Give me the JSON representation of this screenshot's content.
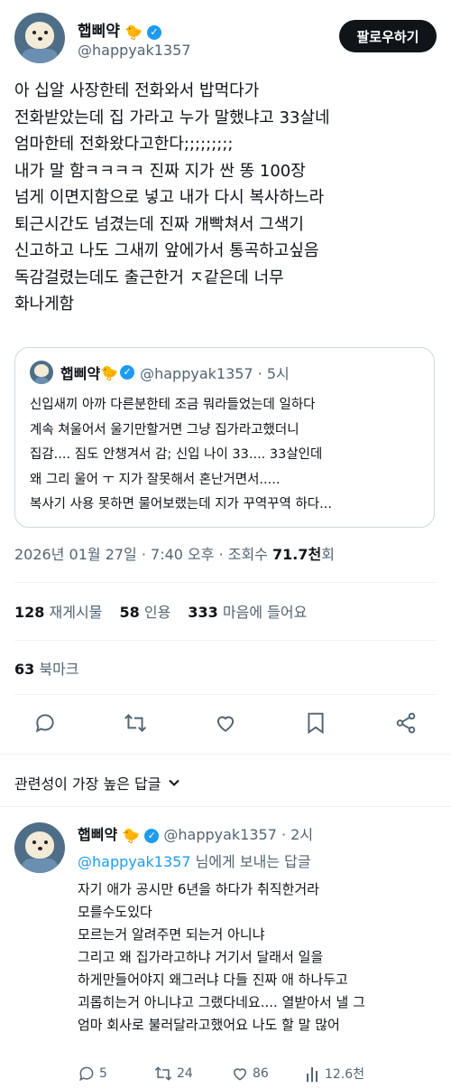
{
  "header": {
    "display_name": "햅삐약",
    "handle": "@happyak1357",
    "follow_label": "팔로우하기"
  },
  "tweet": {
    "lines": [
      "아 십알 사장한테 전화와서 밥먹다가",
      "전화받았는데 집 가라고 누가 말했냐고 33살네",
      "엄마한테 전화왔다고한다;;;;;;;;;",
      "내가 말 함ㅋㅋㅋㅋ 진짜 지가 싼 똥 100장",
      "넘게 이면지함으로 넣고 내가 다시 복사하느라",
      "퇴근시간도 넘겼는데 진짜 개빡쳐서 그색기",
      "신고하고 나도 그새끼 앞에가서 통곡하고싶음",
      "독감걸렸는데도 출근한거 ㅈ같은데 너무",
      "화나게함"
    ]
  },
  "quote": {
    "display_name": "햅삐약",
    "handle_time": "@happyak1357 · 5시",
    "lines": [
      "신입새끼 아까 다른분한테 조금 뭐라들었는데 일하다",
      "계속 쳐울어서 울기만할거면 그냥 집가라고했더니",
      "집감.... 짐도 안챙겨서 감; 신입 나이 33.... 33살인데",
      "왜 그리 울어 ㅜ 지가 잘못해서 혼난거면서.....",
      "복사기 사용 못하면 물어보랬는데 지가 꾸역꾸역 하다..."
    ]
  },
  "meta": {
    "timestamp": "2026년 01월 27일 · 7:40 오후 · 조회수 ",
    "views": "71.7천",
    "views_suffix": "회"
  },
  "stats": {
    "retweets_count": "128",
    "retweets_label": "재게시물",
    "quotes_count": "58",
    "quotes_label": "인용",
    "likes_count": "333",
    "likes_label": "마음에 들어요",
    "bookmarks_count": "63",
    "bookmarks_label": "북마크"
  },
  "replies_sort": {
    "label": "관련성이 가장 높은 답글"
  },
  "reply": {
    "display_name": "햅삐약",
    "handle_time": "@happyak1357 · 2시",
    "replying_to_handle": "@happyak1357",
    "replying_to_suffix": " 님에게 보내는 답글",
    "lines": [
      "자기 애가 공시만 6년을 하다가 취직한거라",
      "모를수도있다",
      "모르는거 알려주면 되는거 아니냐",
      "그리고 왜 집가라고하냐 거기서 달래서 일을",
      "하게만들어야지 왜그러냐 다들 진짜 애 하나두고",
      "괴롭히는거 아니냐고 그랬다네요.... 열받아서 낼 그",
      "엄마 회사로 불러달라고했어요 나도 할 말 많어"
    ],
    "reply_count": "5",
    "retweet_count": "24",
    "like_count": "86",
    "view_count": "12.6천"
  },
  "icons": {
    "accent": "#1d9bf0",
    "text": "#0f1419",
    "muted": "#536471"
  }
}
